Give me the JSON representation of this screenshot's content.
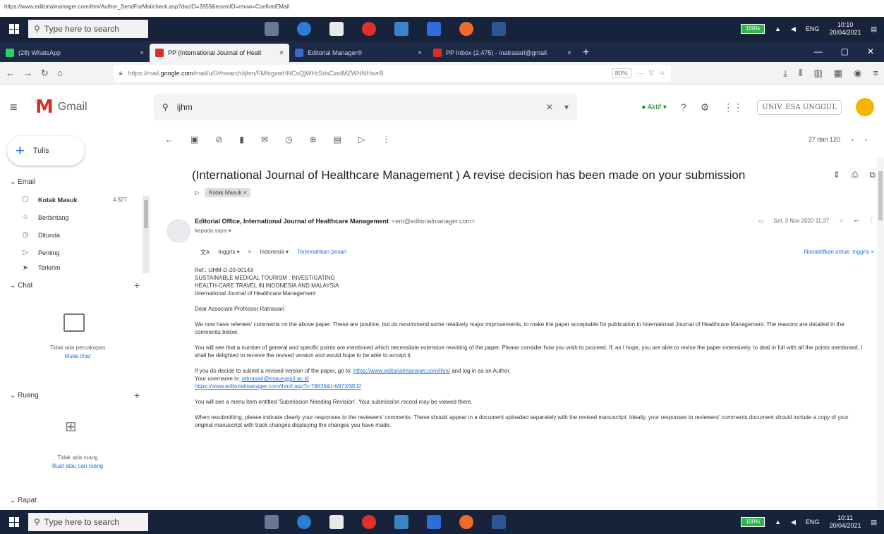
{
  "url_strip": "https://www.editorialmanager.com/ihm/Author_SendForMailcheck.asp?docID=2859&msrmID=rmvw=ConfirmEMail",
  "taskbar": {
    "search_placeholder": "Type here to search",
    "battery": "100%",
    "lang": "ENG",
    "time_top": "10:10",
    "date_top": "20/04/2021",
    "time_bottom": "10:11",
    "date_bottom": "20/04/2021"
  },
  "tabs": [
    {
      "label": "(28) WhatsApp",
      "color": "#25d366"
    },
    {
      "label": "PP (International Journal of Healt",
      "color": "#d93025",
      "active": true
    },
    {
      "label": "Editorial Manager®",
      "color": "#3b6cc4"
    },
    {
      "label": "PP Inbox (2,475) - inatrasari@gmail",
      "color": "#d93025"
    }
  ],
  "address": {
    "url_prefix": "https://mail.",
    "url_domain": "google.com",
    "url_rest": "/mail/u/0/#search/ijhm/FMfcgxwHNCsQjWHrSdsCwdMZWHNHsvrB",
    "zoom": "80%"
  },
  "gmail": {
    "brand": "Gmail",
    "search_query": "ijhm",
    "status": "Aktif",
    "account_logo": "UNIV. ESA UNGGUL"
  },
  "sidebar": {
    "compose": "Tulis",
    "email_section": "Email",
    "items": [
      {
        "label": "Kotak Masuk",
        "count": "4.827",
        "icon": "inbox-icon",
        "glyph": "☐"
      },
      {
        "label": "Berbintang",
        "count": "",
        "icon": "star-icon",
        "glyph": "☆"
      },
      {
        "label": "Ditunda",
        "count": "",
        "icon": "clock-icon",
        "glyph": "◷"
      },
      {
        "label": "Penting",
        "count": "",
        "icon": "important-icon",
        "glyph": "▷"
      },
      {
        "label": "Terkirim",
        "count": "",
        "icon": "sent-icon",
        "glyph": "➤"
      }
    ],
    "chat_section": "Chat",
    "chat_empty": "Tidak ada percakapan",
    "chat_link": "Mulai chat",
    "rooms_section": "Ruang",
    "rooms_empty": "Tidak ada ruang",
    "rooms_link": "Buat atau cari ruang",
    "meet_section": "Rapat"
  },
  "email": {
    "pager": "27 dari 120",
    "subject": "(International Journal of Healthcare Management ) A revise decision has been made on your submission",
    "label_chip": "Kotak Masuk ×",
    "sender_name": "Editorial Office, International Journal of Healthcare Management",
    "sender_email": "<em@editorialmanager.com>",
    "to_line": "kepada saya ▾",
    "date": "Sel, 3 Nov 2020 11.37",
    "translate_from": "Inggris ▾",
    "translate_arrow": ">",
    "translate_to": "Indonesia ▾",
    "translate_link": "Terjemahkan pesan",
    "translate_off": "Nonaktifkan untuk: Inggris ×",
    "ref_line": "Ref.: IJHM-D-20-00143",
    "title_line1": "SUSTAINABLE MEDICAL TOURISM : INVESTIGATING",
    "title_line2": "HEALTH-CARE TRAVEL IN INDONESIA AND MALAYSIA",
    "journal_line": "International Journal of Healthcare Management",
    "greeting": "Dear Associate Professor Ratnasari",
    "para1": "We now have referees' comments on the above paper. These are positive, but do recommend some relatively major improvements, to make the paper acceptable for publication in International Journal of Healthcare Management. The reasons are detailed in the comments below.",
    "para2": "You will see that a number of general and specific points are mentioned which necessitate extensive rewriting of the paper. Please consider how you wish to proceed. If, as I hope, you are able to revise the paper extensively, to deal in full with all the points mentioned, I shall be delighted to receive the revised version and would hope to be able to accept it.",
    "para3_text": "If you do decide to submit a revised version of the paper, go to:",
    "para3_link": "https://www.editorialmanager.com/ihm/",
    "para3_tail": "and log in as an Author.",
    "username_label": "Your username is:",
    "username_link": "ratnasari@esaunggul.ac.id",
    "reset_link": "https://www.editorialmanager.com/ihm/l.asp?i=78839&l=MI7X5RJ2",
    "para4": "You will see a menu item entitled 'Submission Needing Revision'. Your submission record may be viewed there.",
    "para5": "When resubmitting, please indicate clearly your responses to the reviewers' comments. These should appear in a document uploaded separately with the revised manuscript. Ideally, your responses to reviewers' comments document should include a copy of your original manuscript with track changes displaying the changes you have made."
  }
}
